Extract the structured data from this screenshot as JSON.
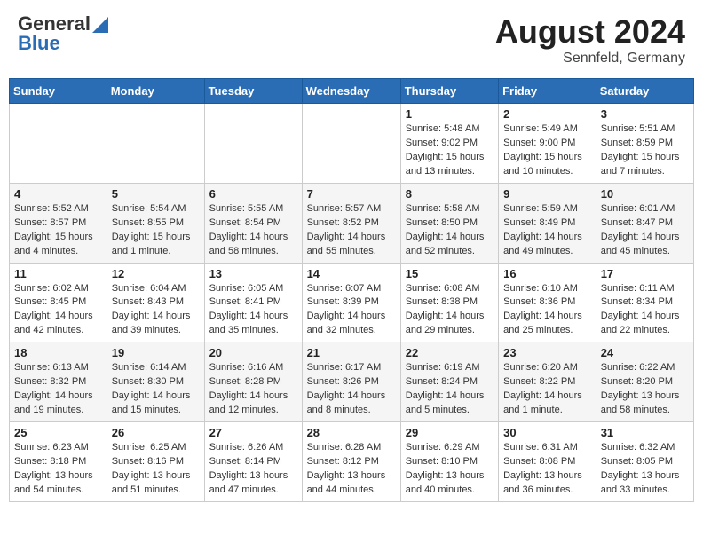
{
  "header": {
    "logo_general": "General",
    "logo_blue": "Blue",
    "month_year": "August 2024",
    "location": "Sennfeld, Germany"
  },
  "days_of_week": [
    "Sunday",
    "Monday",
    "Tuesday",
    "Wednesday",
    "Thursday",
    "Friday",
    "Saturday"
  ],
  "weeks": [
    [
      {
        "day": "",
        "info": ""
      },
      {
        "day": "",
        "info": ""
      },
      {
        "day": "",
        "info": ""
      },
      {
        "day": "",
        "info": ""
      },
      {
        "day": "1",
        "info": "Sunrise: 5:48 AM\nSunset: 9:02 PM\nDaylight: 15 hours\nand 13 minutes."
      },
      {
        "day": "2",
        "info": "Sunrise: 5:49 AM\nSunset: 9:00 PM\nDaylight: 15 hours\nand 10 minutes."
      },
      {
        "day": "3",
        "info": "Sunrise: 5:51 AM\nSunset: 8:59 PM\nDaylight: 15 hours\nand 7 minutes."
      }
    ],
    [
      {
        "day": "4",
        "info": "Sunrise: 5:52 AM\nSunset: 8:57 PM\nDaylight: 15 hours\nand 4 minutes."
      },
      {
        "day": "5",
        "info": "Sunrise: 5:54 AM\nSunset: 8:55 PM\nDaylight: 15 hours\nand 1 minute."
      },
      {
        "day": "6",
        "info": "Sunrise: 5:55 AM\nSunset: 8:54 PM\nDaylight: 14 hours\nand 58 minutes."
      },
      {
        "day": "7",
        "info": "Sunrise: 5:57 AM\nSunset: 8:52 PM\nDaylight: 14 hours\nand 55 minutes."
      },
      {
        "day": "8",
        "info": "Sunrise: 5:58 AM\nSunset: 8:50 PM\nDaylight: 14 hours\nand 52 minutes."
      },
      {
        "day": "9",
        "info": "Sunrise: 5:59 AM\nSunset: 8:49 PM\nDaylight: 14 hours\nand 49 minutes."
      },
      {
        "day": "10",
        "info": "Sunrise: 6:01 AM\nSunset: 8:47 PM\nDaylight: 14 hours\nand 45 minutes."
      }
    ],
    [
      {
        "day": "11",
        "info": "Sunrise: 6:02 AM\nSunset: 8:45 PM\nDaylight: 14 hours\nand 42 minutes."
      },
      {
        "day": "12",
        "info": "Sunrise: 6:04 AM\nSunset: 8:43 PM\nDaylight: 14 hours\nand 39 minutes."
      },
      {
        "day": "13",
        "info": "Sunrise: 6:05 AM\nSunset: 8:41 PM\nDaylight: 14 hours\nand 35 minutes."
      },
      {
        "day": "14",
        "info": "Sunrise: 6:07 AM\nSunset: 8:39 PM\nDaylight: 14 hours\nand 32 minutes."
      },
      {
        "day": "15",
        "info": "Sunrise: 6:08 AM\nSunset: 8:38 PM\nDaylight: 14 hours\nand 29 minutes."
      },
      {
        "day": "16",
        "info": "Sunrise: 6:10 AM\nSunset: 8:36 PM\nDaylight: 14 hours\nand 25 minutes."
      },
      {
        "day": "17",
        "info": "Sunrise: 6:11 AM\nSunset: 8:34 PM\nDaylight: 14 hours\nand 22 minutes."
      }
    ],
    [
      {
        "day": "18",
        "info": "Sunrise: 6:13 AM\nSunset: 8:32 PM\nDaylight: 14 hours\nand 19 minutes."
      },
      {
        "day": "19",
        "info": "Sunrise: 6:14 AM\nSunset: 8:30 PM\nDaylight: 14 hours\nand 15 minutes."
      },
      {
        "day": "20",
        "info": "Sunrise: 6:16 AM\nSunset: 8:28 PM\nDaylight: 14 hours\nand 12 minutes."
      },
      {
        "day": "21",
        "info": "Sunrise: 6:17 AM\nSunset: 8:26 PM\nDaylight: 14 hours\nand 8 minutes."
      },
      {
        "day": "22",
        "info": "Sunrise: 6:19 AM\nSunset: 8:24 PM\nDaylight: 14 hours\nand 5 minutes."
      },
      {
        "day": "23",
        "info": "Sunrise: 6:20 AM\nSunset: 8:22 PM\nDaylight: 14 hours\nand 1 minute."
      },
      {
        "day": "24",
        "info": "Sunrise: 6:22 AM\nSunset: 8:20 PM\nDaylight: 13 hours\nand 58 minutes."
      }
    ],
    [
      {
        "day": "25",
        "info": "Sunrise: 6:23 AM\nSunset: 8:18 PM\nDaylight: 13 hours\nand 54 minutes."
      },
      {
        "day": "26",
        "info": "Sunrise: 6:25 AM\nSunset: 8:16 PM\nDaylight: 13 hours\nand 51 minutes."
      },
      {
        "day": "27",
        "info": "Sunrise: 6:26 AM\nSunset: 8:14 PM\nDaylight: 13 hours\nand 47 minutes."
      },
      {
        "day": "28",
        "info": "Sunrise: 6:28 AM\nSunset: 8:12 PM\nDaylight: 13 hours\nand 44 minutes."
      },
      {
        "day": "29",
        "info": "Sunrise: 6:29 AM\nSunset: 8:10 PM\nDaylight: 13 hours\nand 40 minutes."
      },
      {
        "day": "30",
        "info": "Sunrise: 6:31 AM\nSunset: 8:08 PM\nDaylight: 13 hours\nand 36 minutes."
      },
      {
        "day": "31",
        "info": "Sunrise: 6:32 AM\nSunset: 8:05 PM\nDaylight: 13 hours\nand 33 minutes."
      }
    ]
  ]
}
